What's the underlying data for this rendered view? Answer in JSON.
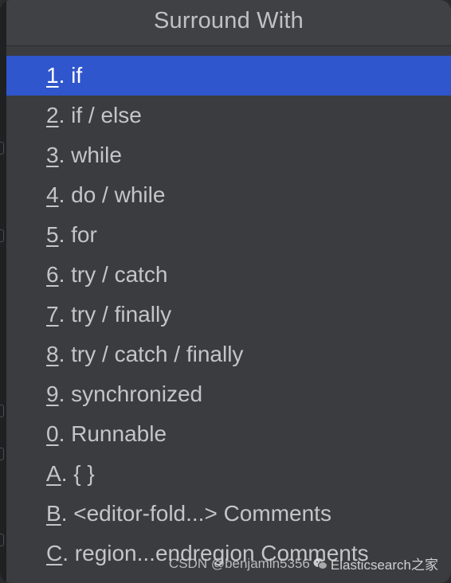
{
  "popup": {
    "title": "Surround With",
    "items": [
      {
        "key": "1",
        "label": ". if",
        "selected": true
      },
      {
        "key": "2",
        "label": ". if / else"
      },
      {
        "key": "3",
        "label": ". while"
      },
      {
        "key": "4",
        "label": ". do / while"
      },
      {
        "key": "5",
        "label": ". for"
      },
      {
        "key": "6",
        "label": ". try / catch"
      },
      {
        "key": "7",
        "label": ". try / finally"
      },
      {
        "key": "8",
        "label": ". try / catch / finally"
      },
      {
        "key": "9",
        "label": ". synchronized"
      },
      {
        "key": "0",
        "label": ". Runnable"
      },
      {
        "key": "A",
        "label": ". { }"
      },
      {
        "key": "B",
        "label": ". <editor-fold...> Comments"
      },
      {
        "key": "C",
        "label": ". region...endregion Comments"
      }
    ]
  },
  "watermark": {
    "source": "CSDN @benjamin5356",
    "brand": "Elasticsearch之家",
    "icon": "wechat-icon"
  },
  "colors": {
    "background": "#3a3c3f",
    "selected": "#2f56cc",
    "text": "#c3c5c8"
  }
}
